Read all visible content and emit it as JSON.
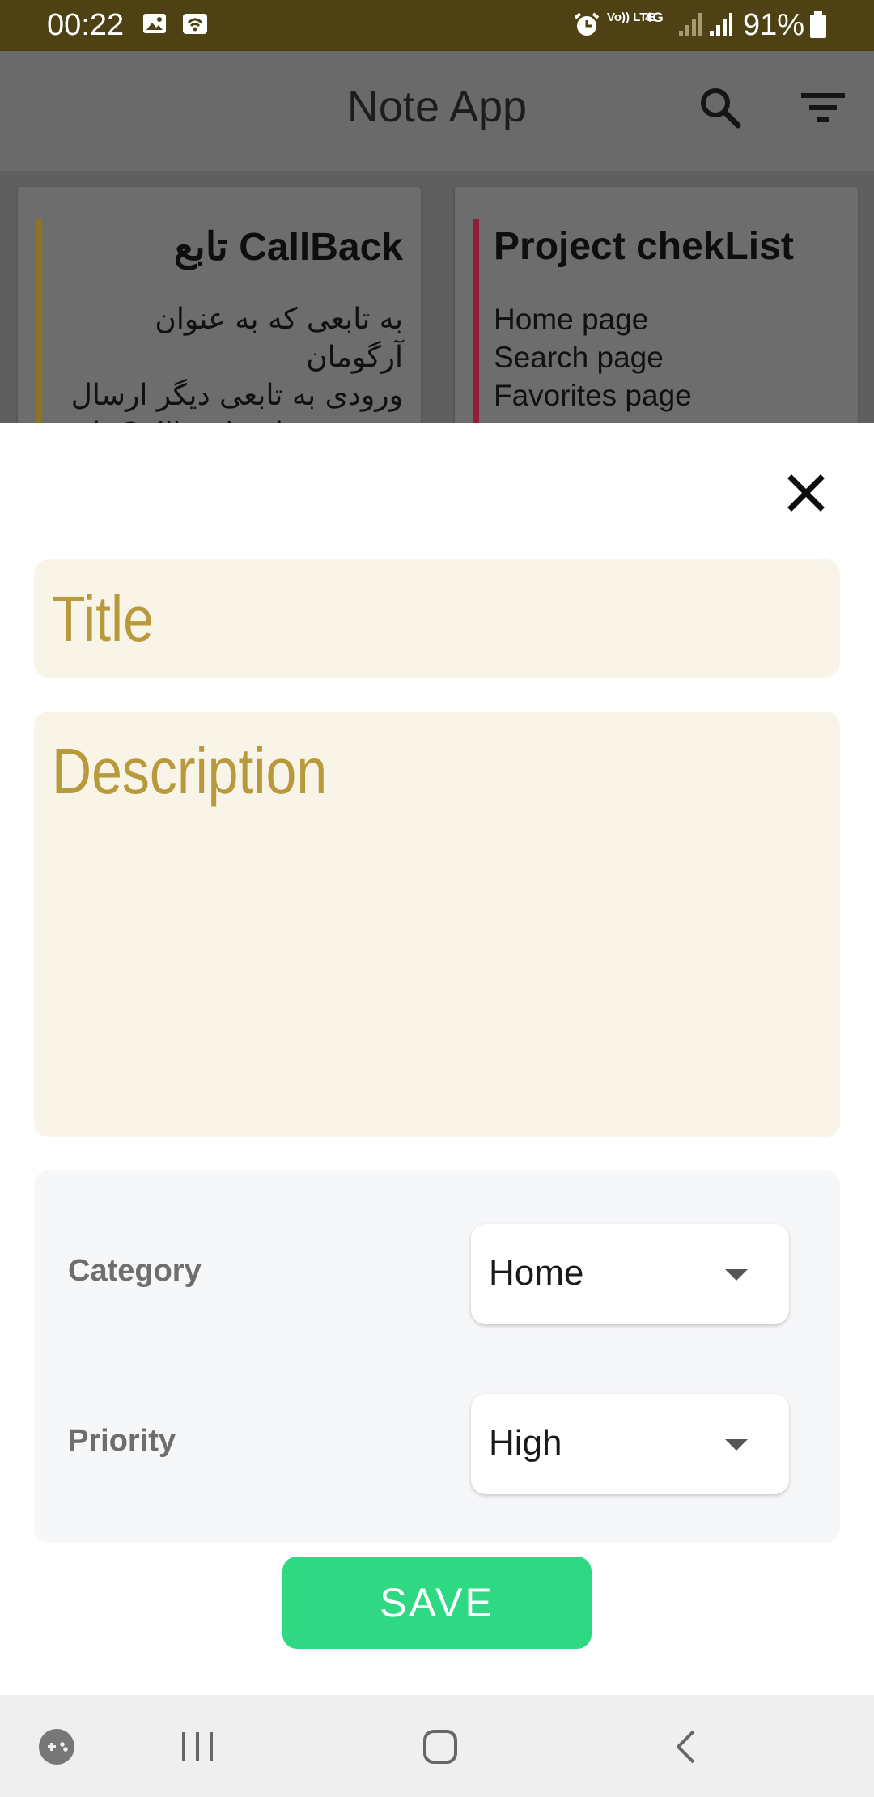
{
  "status_bar": {
    "time": "00:22",
    "battery": "91%",
    "icons": [
      "gallery-icon",
      "wifi-icon",
      "alarm-icon",
      "volte-icon",
      "4g-icon",
      "signal-icon",
      "signal-icon",
      "battery-icon"
    ],
    "volte_label": "Vo)) LTE",
    "network_label": "4G"
  },
  "app_bar": {
    "title": "Note App",
    "icons": [
      "search-icon",
      "filter-icon"
    ]
  },
  "notes": [
    {
      "title": "CallBack تابع",
      "body": "به تابعی که به عنوان آرگومان\nورودی به تابعی دیگر ارسال\nمی‌شود، تابع Callback یا",
      "accent": "#b38f1e"
    },
    {
      "title": "Project chekList",
      "body": "Home page\nSearch page\n Favorites page",
      "accent": "#b0123f"
    }
  ],
  "sheet": {
    "title_placeholder": "Title",
    "description_placeholder": "Description",
    "category_label": "Category",
    "category_value": "Home",
    "priority_label": "Priority",
    "priority_value": "High",
    "save_label": "SAVE"
  },
  "colors": {
    "status_bar": "#4e4215",
    "field_bg": "#f8f4e8",
    "placeholder": "#b89a3c",
    "save": "#2fd883"
  },
  "nav_bar": {
    "icons": [
      "game-tools-icon",
      "recent-apps-icon",
      "home-icon",
      "back-icon"
    ]
  }
}
